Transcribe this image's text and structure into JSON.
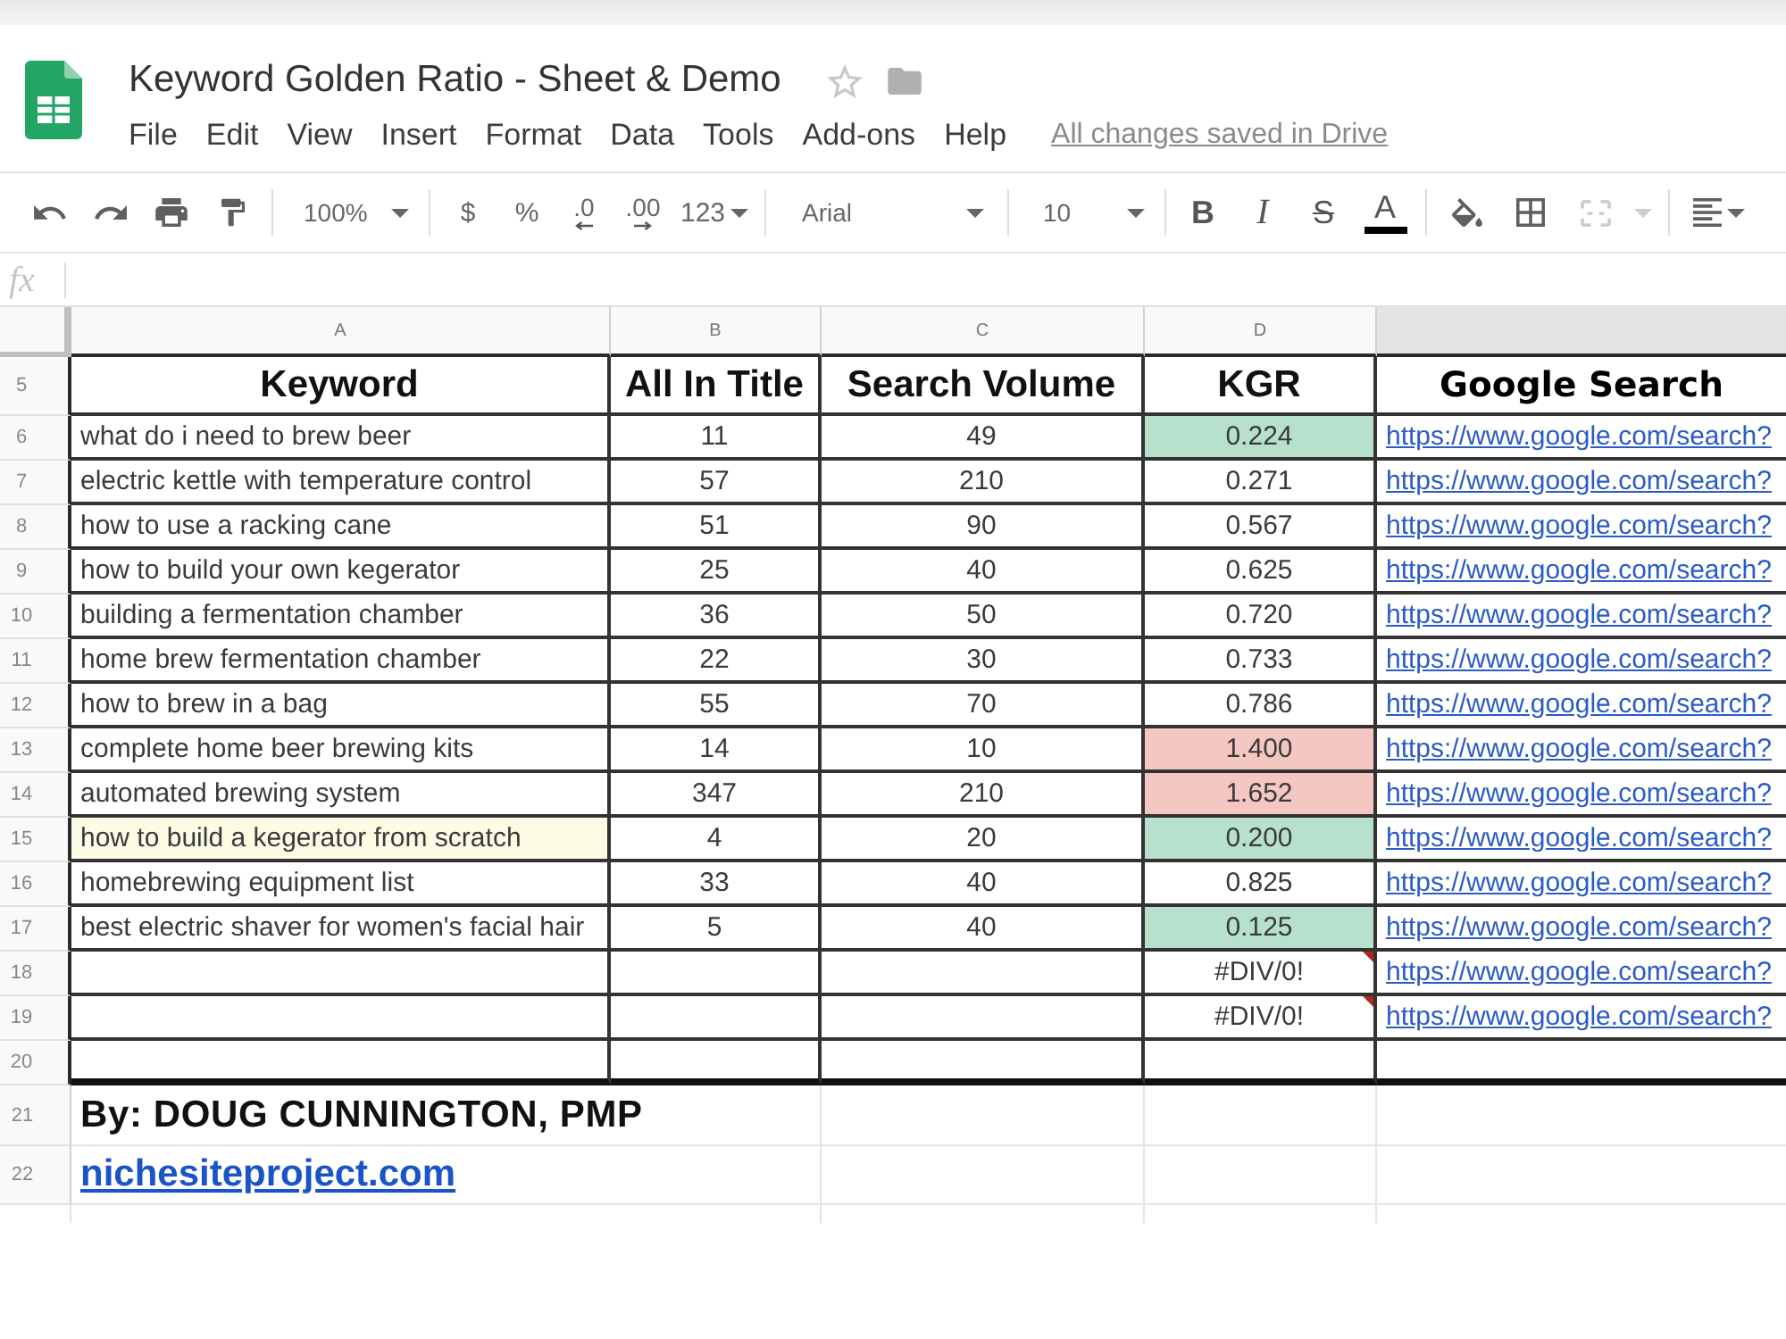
{
  "window": {
    "title": "Keyword Golden Ratio - Sheet & Demo",
    "menu": [
      "File",
      "Edit",
      "View",
      "Insert",
      "Format",
      "Data",
      "Tools",
      "Add-ons",
      "Help"
    ],
    "save_status": "All changes saved in Drive"
  },
  "toolbar": {
    "zoom": "100%",
    "currency": "$",
    "percent": "%",
    "decrease_decimals": ".0",
    "increase_decimals": ".00",
    "more_formats": "123",
    "font": "Arial",
    "font_size": "10",
    "bold": "B",
    "italic": "I",
    "strikethrough": "S",
    "text_color": "A",
    "merge_disabled": true
  },
  "formula_bar": {
    "label": "fx"
  },
  "sheet": {
    "column_letters": [
      "A",
      "B",
      "C",
      "D"
    ],
    "header_row": {
      "row": "5",
      "cells": [
        "Keyword",
        "All In Title",
        "Search Volume",
        "KGR",
        "Google Search"
      ]
    },
    "rows": [
      {
        "row": "6",
        "keyword": {
          "text": "what do i need to brew beer",
          "color": "#ffffff"
        },
        "all_in_title": "11",
        "search_volume": "49",
        "kgr": {
          "text": "0.224",
          "color": "#b7e1cd",
          "error": false
        },
        "link": "https://www.google.com/search?"
      },
      {
        "row": "7",
        "keyword": {
          "text": "electric kettle with temperature control",
          "color": "#ffffff"
        },
        "all_in_title": "57",
        "search_volume": "210",
        "kgr": {
          "text": "0.271",
          "color": "#ffffff",
          "error": false
        },
        "link": "https://www.google.com/search?"
      },
      {
        "row": "8",
        "keyword": {
          "text": "how to use a racking cane",
          "color": "#ffffff"
        },
        "all_in_title": "51",
        "search_volume": "90",
        "kgr": {
          "text": "0.567",
          "color": "#ffffff",
          "error": false
        },
        "link": "https://www.google.com/search?"
      },
      {
        "row": "9",
        "keyword": {
          "text": "how to build your own kegerator",
          "color": "#ffffff"
        },
        "all_in_title": "25",
        "search_volume": "40",
        "kgr": {
          "text": "0.625",
          "color": "#ffffff",
          "error": false
        },
        "link": "https://www.google.com/search?"
      },
      {
        "row": "10",
        "keyword": {
          "text": "building a fermentation chamber",
          "color": "#ffffff"
        },
        "all_in_title": "36",
        "search_volume": "50",
        "kgr": {
          "text": "0.720",
          "color": "#ffffff",
          "error": false
        },
        "link": "https://www.google.com/search?"
      },
      {
        "row": "11",
        "keyword": {
          "text": "home brew fermentation chamber",
          "color": "#ffffff"
        },
        "all_in_title": "22",
        "search_volume": "30",
        "kgr": {
          "text": "0.733",
          "color": "#ffffff",
          "error": false
        },
        "link": "https://www.google.com/search?"
      },
      {
        "row": "12",
        "keyword": {
          "text": "how to brew in a bag",
          "color": "#ffffff"
        },
        "all_in_title": "55",
        "search_volume": "70",
        "kgr": {
          "text": "0.786",
          "color": "#ffffff",
          "error": false
        },
        "link": "https://www.google.com/search?"
      },
      {
        "row": "13",
        "keyword": {
          "text": "complete home beer brewing kits",
          "color": "#ffffff"
        },
        "all_in_title": "14",
        "search_volume": "10",
        "kgr": {
          "text": "1.400",
          "color": "#f4c7c3",
          "error": false
        },
        "link": "https://www.google.com/search?"
      },
      {
        "row": "14",
        "keyword": {
          "text": "automated brewing system",
          "color": "#ffffff"
        },
        "all_in_title": "347",
        "search_volume": "210",
        "kgr": {
          "text": "1.652",
          "color": "#f4c7c3",
          "error": false
        },
        "link": "https://www.google.com/search?"
      },
      {
        "row": "15",
        "keyword": {
          "text": "how to build a kegerator from scratch",
          "color": "#fcfbe4"
        },
        "all_in_title": "4",
        "search_volume": "20",
        "kgr": {
          "text": "0.200",
          "color": "#b7e1cd",
          "error": false
        },
        "link": "https://www.google.com/search?"
      },
      {
        "row": "16",
        "keyword": {
          "text": "homebrewing equipment list",
          "color": "#ffffff"
        },
        "all_in_title": "33",
        "search_volume": "40",
        "kgr": {
          "text": "0.825",
          "color": "#ffffff",
          "error": false
        },
        "link": "https://www.google.com/search?"
      },
      {
        "row": "17",
        "keyword": {
          "text": "best electric shaver for women's facial hair",
          "color": "#ffffff"
        },
        "all_in_title": "5",
        "search_volume": "40",
        "kgr": {
          "text": "0.125",
          "color": "#b7e1cd",
          "error": false
        },
        "link": "https://www.google.com/search?"
      },
      {
        "row": "18",
        "kgr": {
          "text": "#DIV/0!",
          "color": "#ffffff",
          "error": true
        },
        "link": "https://www.google.com/search?"
      },
      {
        "row": "19",
        "kgr": {
          "text": "#DIV/0!",
          "color": "#ffffff",
          "error": true
        },
        "link": "https://www.google.com/search?"
      },
      {
        "row": "20"
      }
    ],
    "footer_rows": [
      {
        "row": "21",
        "kind": "text",
        "text": "By: DOUG CUNNINGTON, PMP"
      },
      {
        "row": "22",
        "kind": "link",
        "text": "nichesiteproject.com"
      }
    ]
  }
}
